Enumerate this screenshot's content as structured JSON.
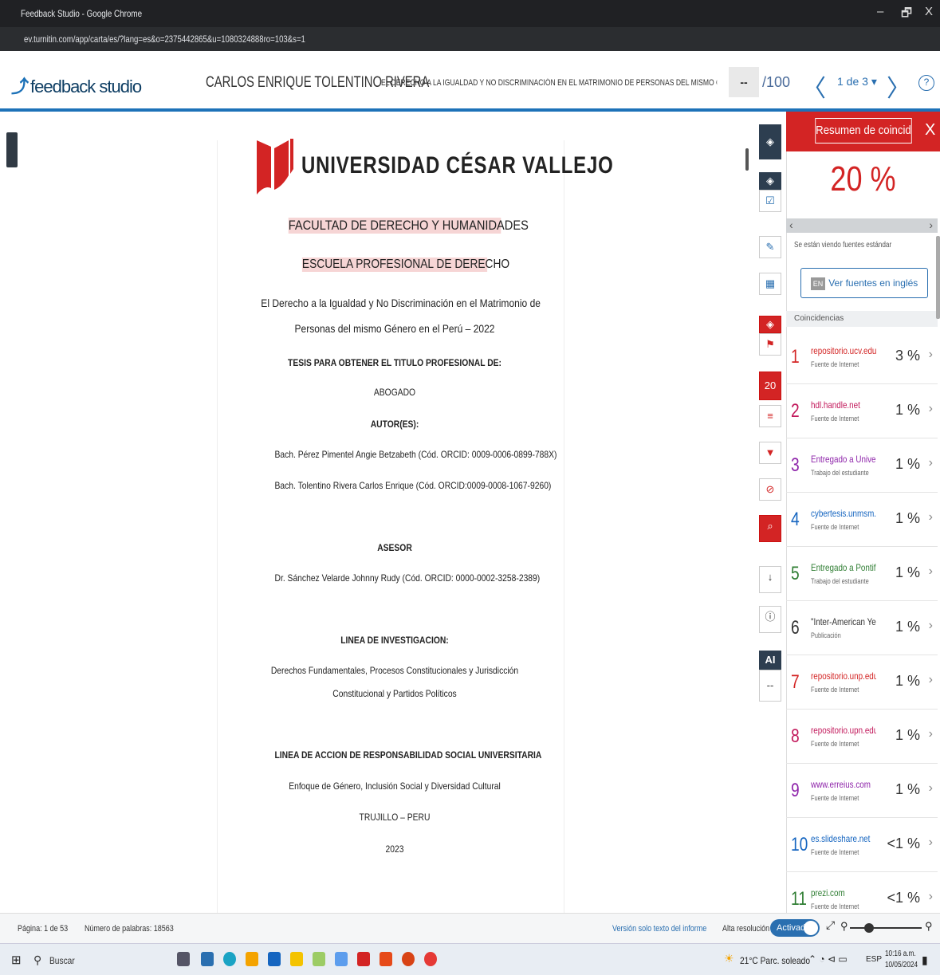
{
  "browser": {
    "window_title": "Feedback Studio - Google Chrome",
    "minimize": "–",
    "restore": "🗗",
    "close": "X",
    "url": "ev.turnitin.com/app/carta/es/?lang=es&o=2375442865&u=1080324888ro=103&s=1"
  },
  "header": {
    "brand": "feedback studio",
    "student": "CARLOS ENRIQUE TOLENTINO RIVERA",
    "paper_title": "EL DERECHO A LA IGUALDAD Y NO DISCRIMINACIÓN EN EL MATRIMONIO DE PERSONAS DEL MISMO GÉNERO EN EL P...",
    "grade": "--",
    "out_of": "/100",
    "page_nav": "1 de 3 ▾",
    "help": "?",
    "prev": "〈",
    "next": "〉"
  },
  "document": {
    "university": "UNIVERSIDAD CÉSAR VALLEJO",
    "lines": [
      "FACULTAD DE DERECHO Y HUMANIDADES",
      "ESCUELA PROFESIONAL DE DERECHO",
      "El Derecho a la Igualdad y No Discriminación en el Matrimonio de",
      "Personas del mismo Género en el Perú – 2022",
      "TESIS PARA OBTENER EL TITULO PROFESIONAL DE:",
      "ABOGADO",
      "AUTOR(ES):",
      "Bach. Pérez Pimentel Angie Betzabeth (Cód. ORCID: 0009-0006-0899-788X)",
      "Bach. Tolentino Rivera Carlos Enrique (Cód. ORCID:0009-0008-1067-9260)",
      "ASESOR",
      "Dr. Sánchez Velarde Johnny Rudy (Cód. ORCID: 0000-0002-3258-2389)",
      "LINEA DE INVESTIGACION:",
      "Derechos Fundamentales, Procesos Constitucionales y Jurisdicción",
      "Constitucional y Partidos Políticos",
      "LINEA DE ACCION DE RESPONSABILIDAD SOCIAL UNIVERSITARIA",
      "Enfoque de Género, Inclusión Social y Diversidad Cultural",
      "TRUJILLO – PERU",
      "2023"
    ]
  },
  "toolbar": {
    "ai": "AI",
    "ai_value": "--",
    "count": "20"
  },
  "panel": {
    "title": "Resumen de coincidencias",
    "close": "X",
    "percent": "20 %",
    "standard_sources": "Se están viendo fuentes estándar",
    "english_button": "Ver fuentes en inglés",
    "en_badge": "EN",
    "matches_header": "Coincidencias",
    "matches": [
      {
        "n": "1",
        "name": "repositorio.ucv.edu.pe",
        "type": "Fuente de Internet",
        "pct": "3 %",
        "color": "#d32424"
      },
      {
        "n": "2",
        "name": "hdl.handle.net",
        "type": "Fuente de Internet",
        "pct": "1 %",
        "color": "#c2185b"
      },
      {
        "n": "3",
        "name": "Entregado a Universida...",
        "type": "Trabajo del estudiante",
        "pct": "1 %",
        "color": "#8e24aa"
      },
      {
        "n": "4",
        "name": "cybertesis.unmsm.edu...",
        "type": "Fuente de Internet",
        "pct": "1 %",
        "color": "#1565c0"
      },
      {
        "n": "5",
        "name": "Entregado a Pontificia ...",
        "type": "Trabajo del estudiante",
        "pct": "1 %",
        "color": "#2e7d32"
      },
      {
        "n": "6",
        "name": "\"Inter-American Yearbo...",
        "type": "Publicación",
        "pct": "1 %",
        "color": "#333333"
      },
      {
        "n": "7",
        "name": "repositorio.unp.edu.pe",
        "type": "Fuente de Internet",
        "pct": "1 %",
        "color": "#d32424"
      },
      {
        "n": "8",
        "name": "repositorio.upn.edu.pe",
        "type": "Fuente de Internet",
        "pct": "1 %",
        "color": "#c2185b"
      },
      {
        "n": "9",
        "name": "www.erreius.com",
        "type": "Fuente de Internet",
        "pct": "1 %",
        "color": "#8e24aa"
      },
      {
        "n": "10",
        "name": "es.slideshare.net",
        "type": "Fuente de Internet",
        "pct": "<1 %",
        "color": "#1565c0"
      },
      {
        "n": "11",
        "name": "prezi.com",
        "type": "Fuente de Internet",
        "pct": "<1 %",
        "color": "#2e7d32"
      }
    ]
  },
  "status": {
    "page": "Página: 1 de 53",
    "words": "Número de palabras: 18563",
    "text_only": "Versión solo texto del informe",
    "hires": "Alta resolución",
    "activated": "Activado"
  },
  "taskbar": {
    "search": "Buscar",
    "weather": "21°C Parc. soleado",
    "lang": "ESP",
    "time": "10:16 a.m.",
    "date": "10/05/2024"
  }
}
